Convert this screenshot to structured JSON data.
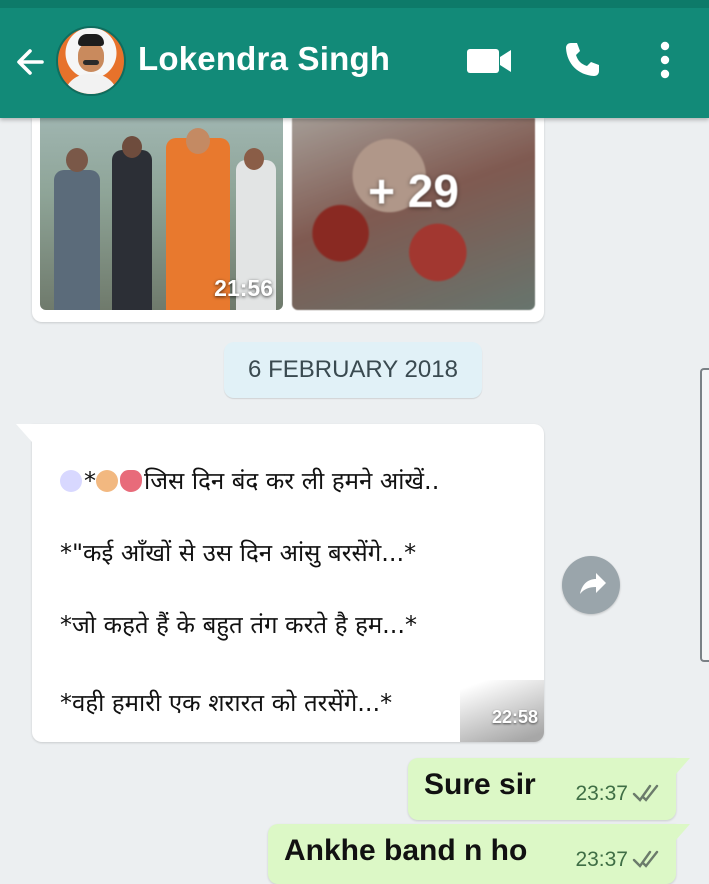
{
  "header": {
    "contact_name": "Lokendra Singh",
    "icons": [
      "back-arrow-icon",
      "video-call-icon",
      "phone-icon",
      "more-vert-icon"
    ]
  },
  "media": {
    "thumb_time": "21:56",
    "more_count": "+ 29"
  },
  "date_chip": "6 FEBRUARY 2018",
  "incoming": {
    "lines": [
      "जिस दिन बंद कर ली हमने आंखें..",
      "*\"कई आँखों से उस दिन आंसु बरसेंगे...*",
      "*जो कहते हैं के बहुत तंग करते है हम...*",
      "*वही हमारी एक शरारत को तरसेंगे...*"
    ],
    "line1_prefix": "*",
    "time": "22:58"
  },
  "outgoing": [
    {
      "text": "Sure sir",
      "time": "23:37"
    },
    {
      "text": "Ankhe band n ho",
      "time": "23:37"
    }
  ],
  "colors": {
    "header": "#128a78",
    "chat_bg": "#eceff1",
    "outgoing_bubble": "#dcf8c6",
    "date_chip": "#e1f1f7"
  }
}
